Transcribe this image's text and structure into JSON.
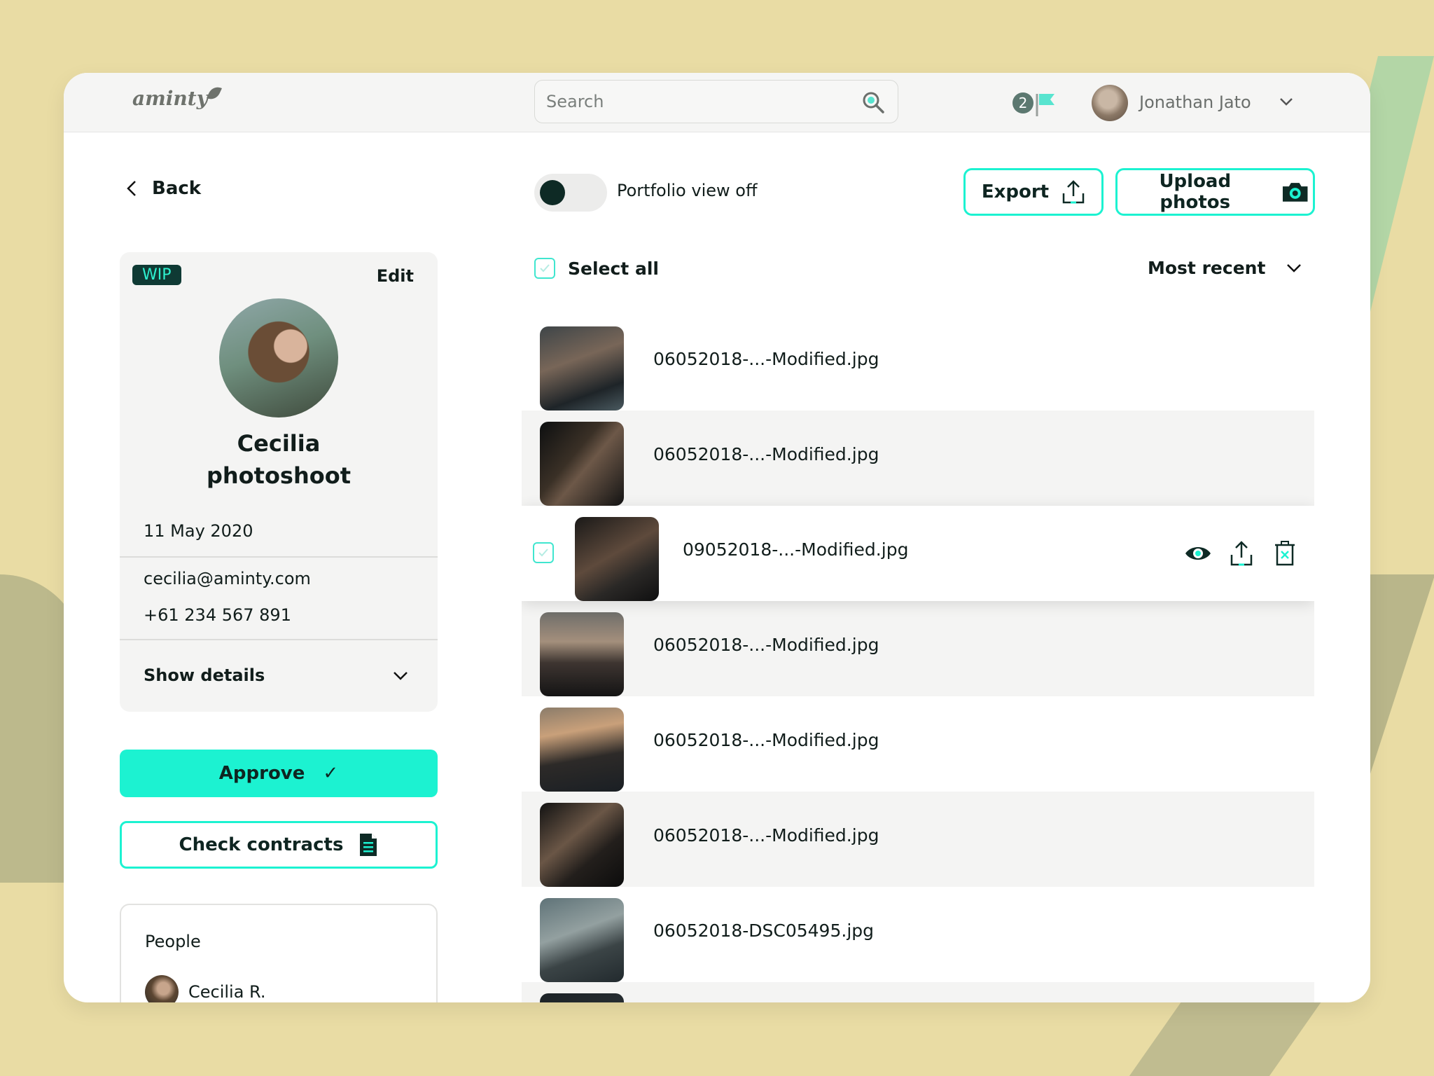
{
  "app": {
    "logo": "aminty"
  },
  "search": {
    "placeholder": "Search"
  },
  "notifications": {
    "count": "2"
  },
  "user": {
    "name": "Jonathan Jato"
  },
  "nav": {
    "back_label": "Back"
  },
  "project": {
    "status": "WIP",
    "edit_label": "Edit",
    "title_line1": "Cecilia",
    "title_line2": "photoshoot",
    "date": "11 May 2020",
    "email": "cecilia@aminty.com",
    "phone": "+61 234 567 891",
    "show_details_label": "Show details"
  },
  "actions": {
    "approve_label": "Approve",
    "approve_check": "✓",
    "check_contracts_label": "Check contracts"
  },
  "people": {
    "title": "People",
    "items": [
      {
        "name": "Cecilia R."
      }
    ]
  },
  "toolbar": {
    "portfolio_toggle_label": "Portfolio view off",
    "portfolio_view_on": false,
    "export_label": "Export",
    "upload_label": "Upload photos"
  },
  "list": {
    "select_all_label": "Select all",
    "sort_label": "Most recent",
    "files": [
      {
        "name": "06052018-...-Modified.jpg"
      },
      {
        "name": "06052018-...-Modified.jpg"
      },
      {
        "name": "09052018-...-Modified.jpg",
        "selected": true
      },
      {
        "name": "06052018-...-Modified.jpg"
      },
      {
        "name": "06052018-...-Modified.jpg"
      },
      {
        "name": "06052018-...-Modified.jpg"
      },
      {
        "name": "06052018-DSC05495.jpg"
      }
    ]
  },
  "colors": {
    "accent": "#1cf2d1",
    "dark": "#0e2a25",
    "background": "#e9dca4"
  }
}
